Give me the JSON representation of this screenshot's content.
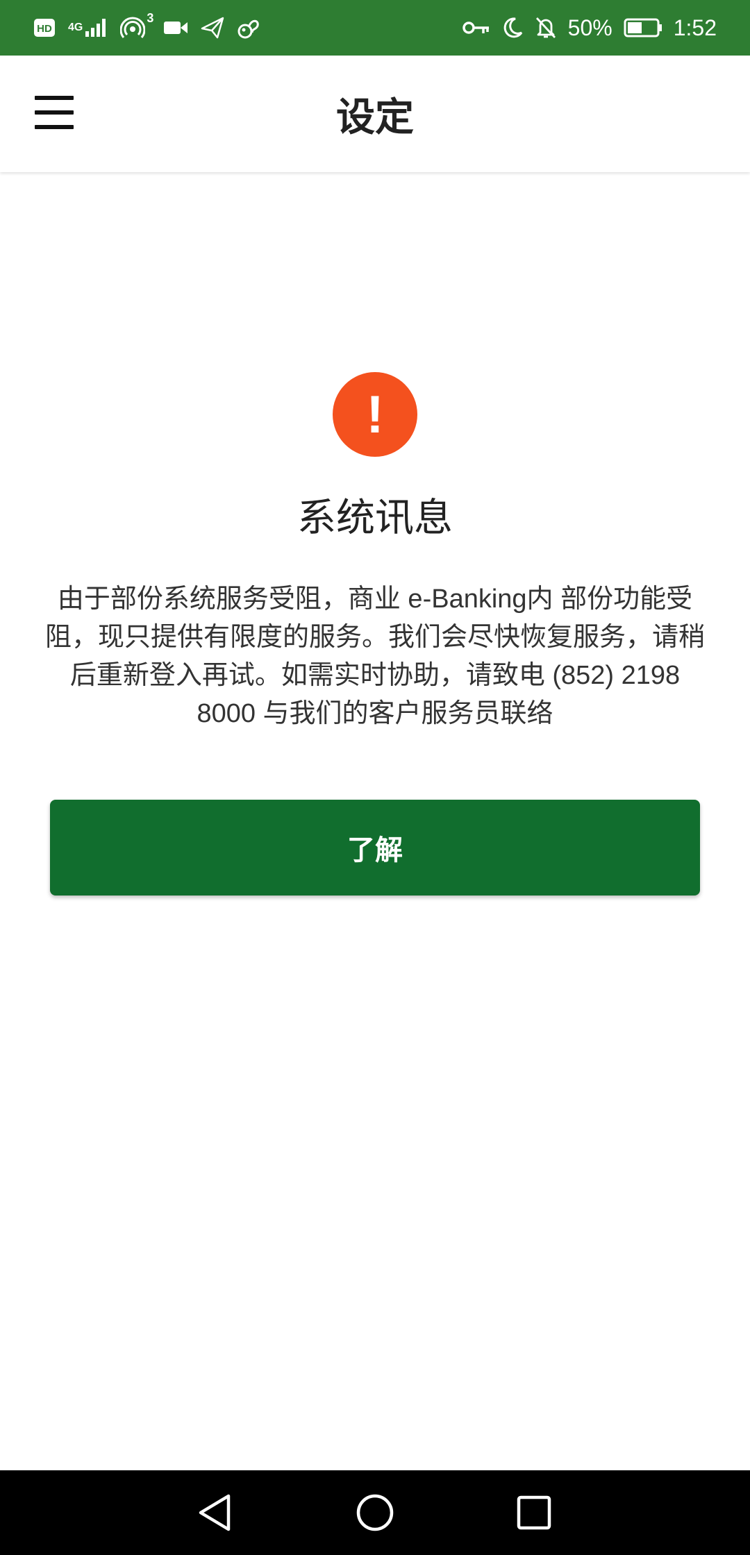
{
  "status_bar": {
    "hd_label": "HD",
    "network_label": "4G",
    "hotspot_count": "3",
    "battery": "50%",
    "time": "1:52",
    "icons": [
      "hd-icon",
      "signal-icon",
      "hotspot-icon",
      "video-icon",
      "paper-plane-icon",
      "squirrel-icon",
      "key-icon",
      "moon-icon",
      "bell-off-icon",
      "battery-icon"
    ],
    "background_color": "#2e7d32"
  },
  "app_bar": {
    "title": "设定",
    "menu_icon": "hamburger-menu-icon"
  },
  "dialog": {
    "icon": "alert-icon",
    "icon_glyph": "!",
    "icon_color": "#f4511e",
    "title": "系统讯息",
    "message": "由于部份系统服务受阻，商业 e-Banking内 部份功能受阻，现只提供有限度的服务。我们会尽快恢复服务，请稍后重新登入再试。如需实时协助，请致电 (852) 2198 8000 与我们的客户服务员联络",
    "button_label": "了解",
    "button_color": "#116e2e"
  },
  "nav_bar": {
    "icons": [
      "back-triangle-icon",
      "home-circle-icon",
      "recents-square-icon"
    ]
  }
}
